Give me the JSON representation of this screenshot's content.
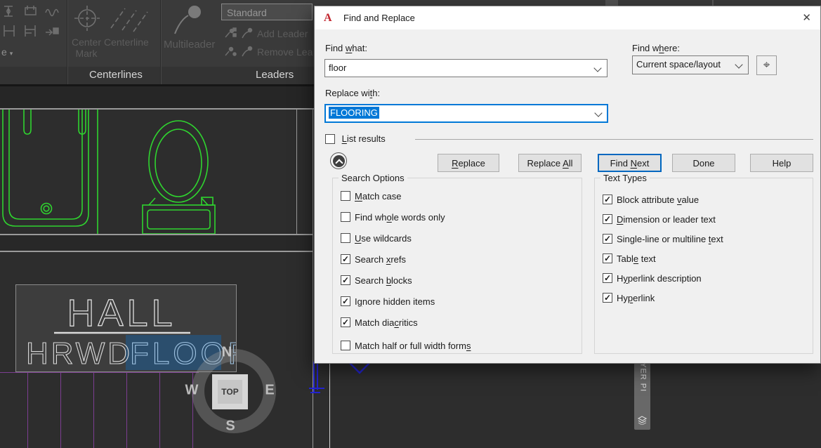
{
  "colors": {
    "accent": "#0078d7",
    "selection_blue": "#0078d7",
    "cad_green": "#2fd42f",
    "cad_purple": "#7c3e91",
    "cad_blue": "#2323cf",
    "floor_highlight": "#2b4e6d"
  },
  "ribbon": {
    "style_combo_value": "Standard",
    "mini_dropdown": "e",
    "launcher_glyph": "↘",
    "centerlines": {
      "center_mark": "Center Mark",
      "centerline": "Centerline",
      "panel": "Centerlines"
    },
    "leaders": {
      "multileader": "Multileader",
      "add_leader": "Add Leader",
      "remove_leader": "Remove Lead",
      "panel": "Leaders"
    }
  },
  "canvas": {
    "hall": "HALL",
    "hrwd": "HRWD",
    "floor": "FLOOR",
    "viewcube": {
      "n": "N",
      "e": "E",
      "s": "S",
      "w": "W",
      "top": "TOP"
    },
    "layer_tab": "LAYER PI"
  },
  "dialog": {
    "title": "Find and Replace",
    "close_glyph": "✕",
    "pick_glyph": "⌖",
    "find_what": {
      "label": {
        "text": "Find what:",
        "u": 5
      },
      "value": "floor"
    },
    "find_where": {
      "label": {
        "text": "Find where:",
        "u": 6
      },
      "value": "Current space/layout"
    },
    "replace_with": {
      "label": {
        "text": "Replace with:",
        "u": 10
      },
      "value": "FLOORING"
    },
    "list_results": {
      "text": "List results",
      "u": 0,
      "checked": false
    },
    "buttons": [
      {
        "text": "Replace",
        "u": 0
      },
      {
        "text": "Replace All",
        "u": 8
      },
      {
        "text": "Find Next",
        "u": 5,
        "primary": true
      },
      {
        "text": "Done",
        "u": -1
      },
      {
        "text": "Help",
        "u": -1
      }
    ],
    "search_options": {
      "title": "Search Options",
      "items": [
        {
          "text": "Match case",
          "u": 0,
          "checked": false
        },
        {
          "text": "Find whole words only",
          "u": 7,
          "checked": false
        },
        {
          "text": "Use wildcards",
          "u": 0,
          "checked": false
        },
        {
          "text": "Search xrefs",
          "u": 7,
          "checked": true
        },
        {
          "text": "Search blocks",
          "u": 7,
          "checked": true
        },
        {
          "text": "Ignore hidden items",
          "u": 1,
          "checked": true
        },
        {
          "text": "Match diacritics",
          "u": 9,
          "checked": true
        },
        {
          "text": "Match half or full width forms",
          "u": 29,
          "checked": false
        }
      ]
    },
    "text_types": {
      "title": "Text Types",
      "items": [
        {
          "text": "Block attribute value",
          "u": 16,
          "checked": true
        },
        {
          "text": "Dimension or leader text",
          "u": 0,
          "checked": true
        },
        {
          "text": "Single-line or multiline text",
          "u": 25,
          "checked": true
        },
        {
          "text": "Table text",
          "u": 4,
          "checked": true
        },
        {
          "text": "Hyperlink description",
          "u": 1,
          "checked": true
        },
        {
          "text": "Hyperlink",
          "u": 2,
          "checked": true
        }
      ]
    }
  }
}
